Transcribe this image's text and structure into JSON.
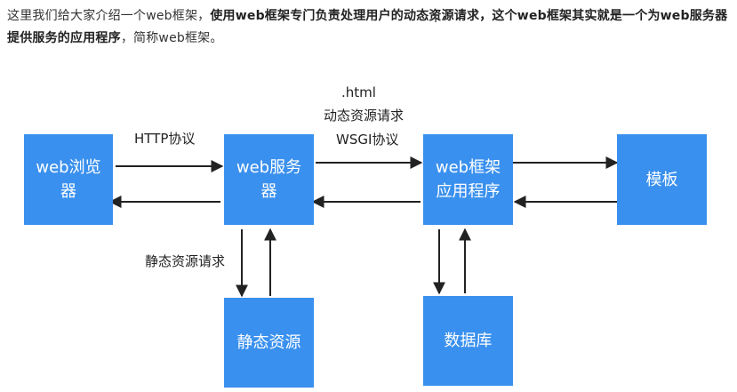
{
  "intro": {
    "part1": "这里我们给大家介绍一个web框架，",
    "part2_bold": "使用web框架专门负责处理用户的动态资源请求，这个web框架其实就是一个为web服务器提供服务的应用程序",
    "part3": "，简称web框架。"
  },
  "diagram": {
    "nodes": {
      "browser": "web浏览器",
      "server": "web服务器",
      "framework": "web框架应用程序",
      "template": "模板",
      "static": "静态资源",
      "database": "数据库"
    },
    "edge_labels": {
      "http": "HTTP协议",
      "html": ".html",
      "dynamic_request": "动态资源请求",
      "wsgi": "WSGI协议",
      "static_request": "静态资源请求"
    },
    "colors": {
      "node_fill": "#3a90ee",
      "node_text": "#ffffff",
      "arrow": "#222222"
    }
  }
}
